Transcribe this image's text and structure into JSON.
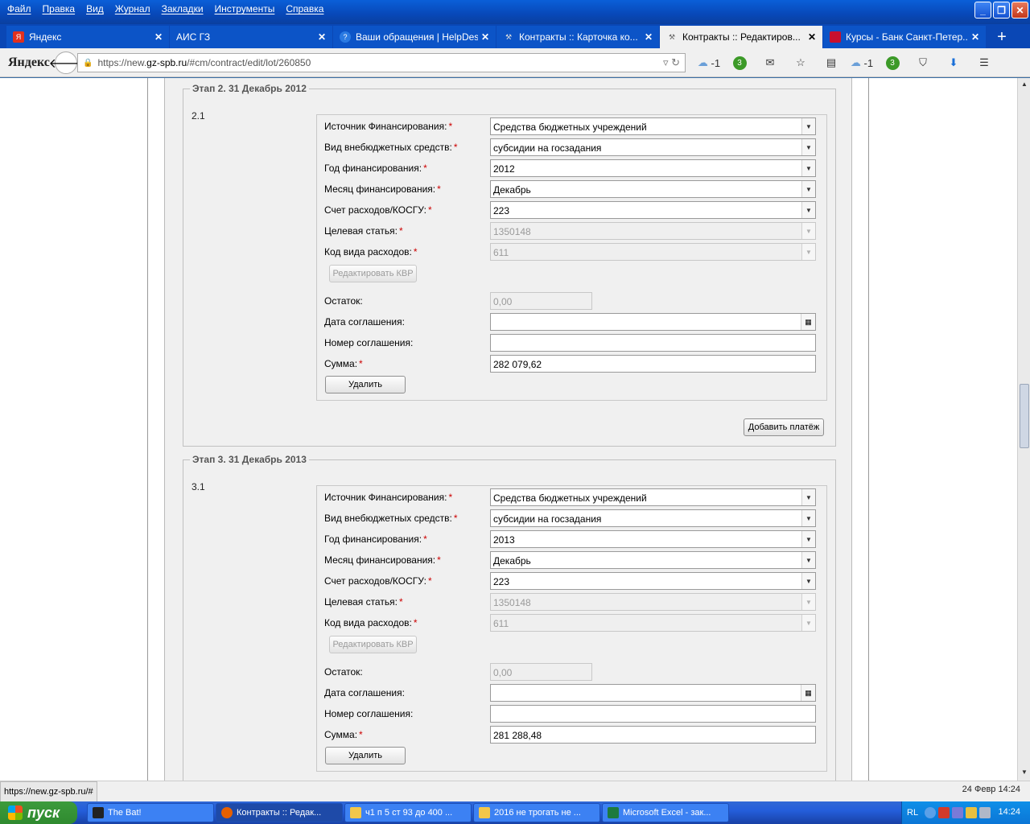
{
  "browser": {
    "menu": [
      "Файл",
      "Правка",
      "Вид",
      "Журнал",
      "Закладки",
      "Инструменты",
      "Справка"
    ],
    "tabs": [
      {
        "label": "Яндекс",
        "icon": "yandex-icon"
      },
      {
        "label": "АИС ГЗ",
        "icon": "blank-page-icon"
      },
      {
        "label": "Ваши обращения | HelpDes...",
        "icon": "help-icon"
      },
      {
        "label": "Контракты :: Карточка ко...",
        "icon": "hammer-icon"
      },
      {
        "label": "Контракты :: Редактиров...",
        "icon": "hammer-icon",
        "active": true
      },
      {
        "label": "Курсы - Банк Санкт-Петер...",
        "icon": "bank-icon"
      }
    ],
    "brand": "Яндекс",
    "url_prefix": "https://new.",
    "url_domain": "gz-spb.ru",
    "url_path": "/#cm/contract/edit/lot/260850",
    "cloud1": "-1",
    "badge1": "3",
    "cloud2": "-1",
    "badge2": "3",
    "status_url": "https://new.gz-spb.ru/#",
    "status_date": "24 Февр 14:24"
  },
  "labels": {
    "source": "Источник Финансирования:",
    "offbudget": "Вид внебюджетных средств:",
    "year": "Год финансирования:",
    "month": "Месяц финансирования:",
    "account": "Счет расходов/КОСГУ:",
    "target": "Целевая статья:",
    "kvr": "Код вида расходов:",
    "edit_kvr": "Редактировать КВР",
    "rest": "Остаток:",
    "agreement_date": "Дата соглашения:",
    "agreement_no": "Номер соглашения:",
    "sum": "Сумма:",
    "delete": "Удалить",
    "add_payment": "Добавить платёж"
  },
  "stages": [
    {
      "legend": "Этап 2. 31 Декабрь 2012",
      "num": "2.1",
      "source": "Средства бюджетных учреждений",
      "offbudget": "субсидии на госзадания",
      "year": "2012",
      "month": "Декабрь",
      "account": "223",
      "target": "1350148",
      "kvr": "611",
      "rest": "0,00",
      "agreement_date": "",
      "agreement_no": "",
      "sum": "282 079,62"
    },
    {
      "legend": "Этап 3. 31 Декабрь 2013",
      "num": "3.1",
      "source": "Средства бюджетных учреждений",
      "offbudget": "субсидии на госзадания",
      "year": "2013",
      "month": "Декабрь",
      "account": "223",
      "target": "1350148",
      "kvr": "611",
      "rest": "0,00",
      "agreement_date": "",
      "agreement_no": "",
      "sum": "281 288,48"
    }
  ],
  "taskbar": {
    "start": "пуск",
    "tasks": [
      "The Bat!",
      "Контракты :: Редак...",
      "ч1 п 5 ст 93 до 400 ...",
      "2016 не трогать не ...",
      "Microsoft Excel - зак..."
    ],
    "lang": "RL",
    "clock": "14:24"
  },
  "colors": {
    "xp_blue": "#0a5fd8",
    "required": "#cc0000",
    "start_green": "#3c9b3c"
  }
}
